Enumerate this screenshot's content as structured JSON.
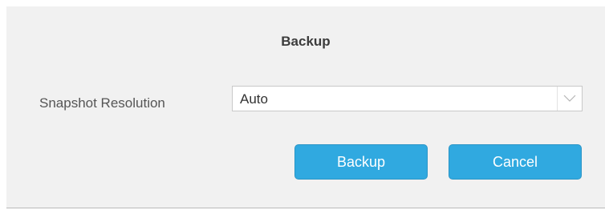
{
  "dialog": {
    "title": "Backup",
    "snapshot_resolution": {
      "label": "Snapshot Resolution",
      "value": "Auto",
      "arrow_icon": "chevron-down-icon"
    },
    "buttons": {
      "backup_label": "Backup",
      "cancel_label": "Cancel"
    },
    "colors": {
      "button_bg": "#30a9e0",
      "dialog_bg": "#f1f1f1"
    }
  }
}
